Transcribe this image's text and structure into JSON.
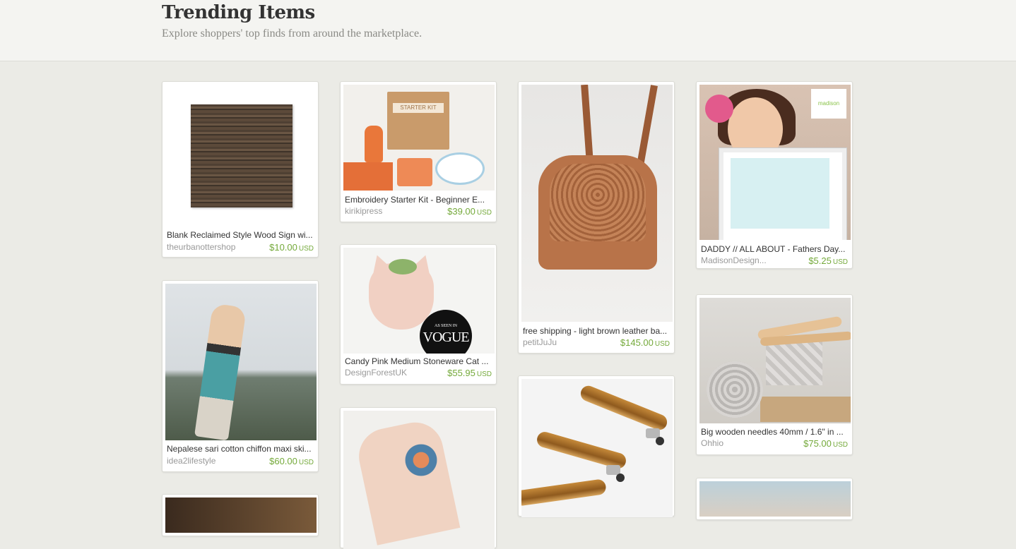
{
  "header": {
    "title": "Trending Items",
    "subtitle": "Explore shoppers' top finds from around the marketplace."
  },
  "items": [
    {
      "title": "Blank Reclaimed Style Wood Sign wi...",
      "shop": "theurbanottershop",
      "price": "$10.00",
      "currency": "USD"
    },
    {
      "title": "Nepalese sari cotton chiffon maxi ski...",
      "shop": "idea2lifestyle",
      "price": "$60.00",
      "currency": "USD"
    },
    {
      "title": "Embroidery Starter Kit - Beginner E...",
      "shop": "kirikipress",
      "price": "$39.00",
      "currency": "USD"
    },
    {
      "title": "Candy Pink Medium Stoneware Cat ...",
      "shop": "DesignForestUK",
      "price": "$55.95",
      "currency": "USD"
    },
    {
      "title": "free shipping - light brown leather ba...",
      "shop": "petitJuJu",
      "price": "$145.00",
      "currency": "USD"
    },
    {
      "title": "DADDY // ALL ABOUT - Fathers Day...",
      "shop": "MadisonDesign...",
      "price": "$5.25",
      "currency": "USD"
    },
    {
      "title": "Big wooden needles 40mm / 1.6\" in ...",
      "shop": "Ohhio",
      "price": "$75.00",
      "currency": "USD"
    }
  ],
  "image_text": {
    "kit_label": "STARTER KIT",
    "vogue_small": "AS SEEN IN",
    "vogue_big": "VOGUE",
    "madison_logo": "madison"
  },
  "colors": {
    "price": "#74a93a",
    "background": "#ebebe6"
  }
}
